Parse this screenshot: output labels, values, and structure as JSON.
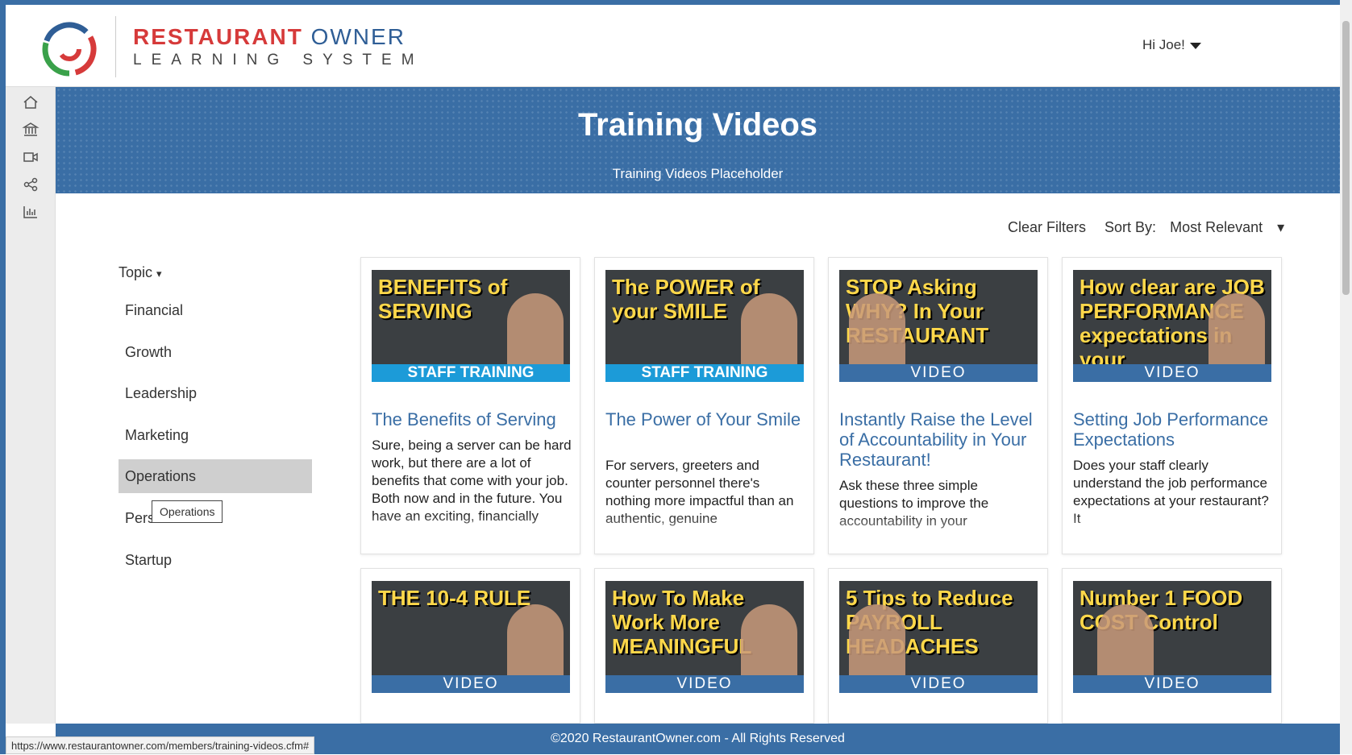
{
  "header": {
    "brand_word1": "RESTAURANT",
    "brand_word2": "OWNER",
    "brand_sub": "LEARNING SYSTEM",
    "user_greeting": "Hi Joe!"
  },
  "rail": [
    "home-icon",
    "institution-icon",
    "video-icon",
    "share-icon",
    "chart-icon"
  ],
  "banner": {
    "title": "Training Videos",
    "subtitle": "Training Videos Placeholder"
  },
  "filters": {
    "clear": "Clear Filters",
    "sort_label": "Sort By:",
    "sort_value": "Most Relevant"
  },
  "topics": {
    "heading": "Topic",
    "items": [
      "Financial",
      "Growth",
      "Leadership",
      "Marketing",
      "Operations",
      "Pers",
      "Startup"
    ],
    "active": "Operations",
    "tooltip": "Operations"
  },
  "cards": [
    {
      "art": "BENEFITS of SERVING",
      "ribbon": "STAFF TRAINING",
      "title": "The Benefits of Serving",
      "desc": "Sure, being a server can be hard work, but there are a lot of benefits that come with your job. Both now and in the future. You have an exciting, financially"
    },
    {
      "art": "The POWER of your SMILE",
      "ribbon": "STAFF TRAINING",
      "title": "The Power of Your Smile",
      "desc": "For servers, greeters and counter personnel there's nothing more impactful than an authentic, genuine"
    },
    {
      "art": "STOP Asking WHY? In Your RESTAURANT",
      "ribbon": "VIDEO",
      "title": "Instantly Raise the Level of Accountability in Your Restaurant!",
      "desc": "Ask these three simple questions to improve the accountability in your"
    },
    {
      "art": "How clear are JOB PERFORMANCE expectations in your RESTAURANT?",
      "ribbon": "VIDEO",
      "title": "Setting Job Performance Expectations",
      "desc": "Does your staff clearly understand the job performance expectations at your restaurant? It"
    },
    {
      "art": "THE 10-4 RULE",
      "ribbon": "VIDEO",
      "title": "",
      "desc": ""
    },
    {
      "art": "How To Make Work More MEANINGFUL",
      "ribbon": "VIDEO",
      "title": "",
      "desc": ""
    },
    {
      "art": "5 Tips to Reduce PAYROLL HEADACHES",
      "ribbon": "VIDEO",
      "title": "",
      "desc": ""
    },
    {
      "art": "Number 1 FOOD COST Control",
      "ribbon": "VIDEO",
      "title": "",
      "desc": ""
    }
  ],
  "footer": {
    "copyright": "©2020 RestaurantOwner.com - All Rights Reserved",
    "status_url": "https://www.restaurantowner.com/members/training-videos.cfm#"
  },
  "colors": {
    "primary": "#3a6ea5",
    "brand_red": "#d63a3a",
    "staff_ribbon": "#1c9bd8",
    "active_topic": "#cfcfcf"
  }
}
